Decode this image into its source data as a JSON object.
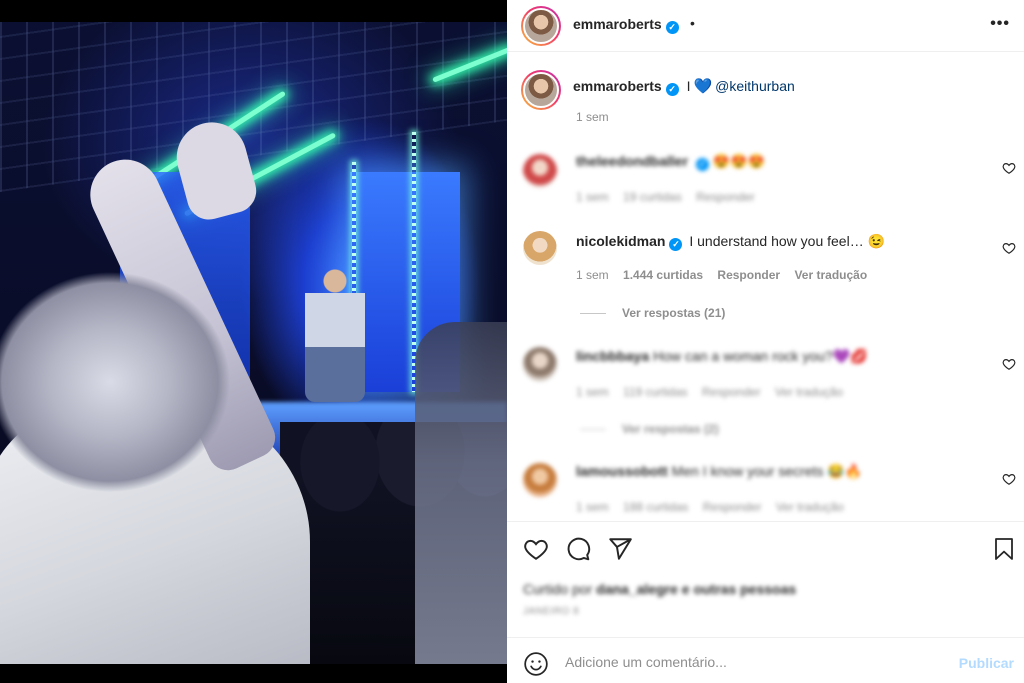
{
  "post": {
    "author": "emmaroberts",
    "follow_dot": "•",
    "more_label": "•••"
  },
  "caption": {
    "author": "emmaroberts",
    "text_before": "I",
    "heart": "💙",
    "mention": "@keithurban",
    "time": "1 sem"
  },
  "comments": [
    {
      "user": "theleedondballer",
      "text": "😍😍😍",
      "time": "1 sem",
      "likes": "19 curtidas",
      "reply": "Responder",
      "blurred": true
    },
    {
      "user": "nicolekidman",
      "text": "I understand how you feel… 😉",
      "time": "1 sem",
      "likes": "1.444 curtidas",
      "reply": "Responder",
      "translate": "Ver tradução",
      "replies_label": "Ver respostas (21)",
      "blurred": false
    },
    {
      "user": "lincbbbaya",
      "text": "How can a woman rock you?💜💋",
      "time": "1 sem",
      "likes": "119 curtidas",
      "reply": "Responder",
      "translate": "Ver tradução",
      "replies_label": "Ver respostas (2)",
      "blurred": true
    },
    {
      "user": "lamoussobott",
      "text": "Men I know your secrets 😂🔥",
      "time": "1 sem",
      "likes": "188 curtidas",
      "reply": "Responder",
      "translate": "Ver tradução",
      "blurred": true
    }
  ],
  "actions": {
    "liked_prefix": "Curtido por",
    "liked_user": "dana_alegre",
    "liked_suffix": "e outras pessoas",
    "date": "JANEIRO 8"
  },
  "add_comment": {
    "placeholder": "Adicione um comentário...",
    "publish_label": "Publicar"
  },
  "icons": {
    "heart": "heart-icon",
    "comment": "comment-icon",
    "share": "share-icon",
    "save": "bookmark-icon",
    "emoji": "emoji-icon",
    "like_small": "heart-outline-icon",
    "verified": "verified-badge-icon"
  },
  "colors": {
    "verified": "#0095f6",
    "publish_disabled": "#b3dbff",
    "muted_text": "#8e8e8e",
    "story_ring_start": "#f9c03a",
    "story_ring_end": "#c12fb0"
  }
}
